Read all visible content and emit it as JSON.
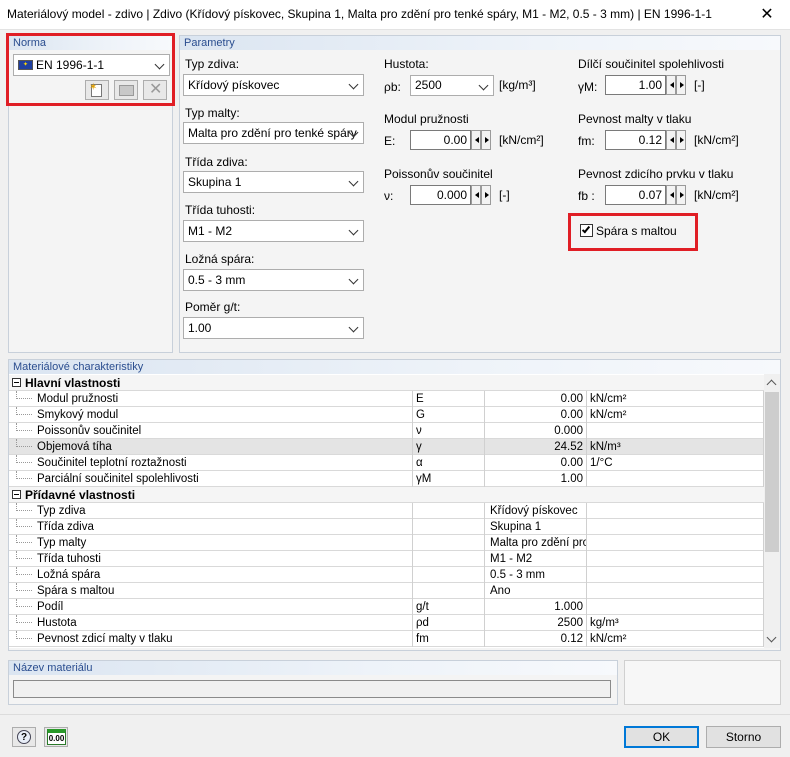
{
  "window": {
    "title": "Materiálový model - zdivo | Zdivo (Křídový pískovec, Skupina 1, Malta pro zdění pro tenké spáry, M1 - M2, 0.5 - 3 mm) | EN 1996-1-1",
    "close": "✕"
  },
  "norma": {
    "header": "Norma",
    "selected": "EN 1996-1-1"
  },
  "parametry": {
    "header": "Parametry",
    "typ_zdiva": {
      "label": "Typ zdiva:",
      "value": "Křídový pískovec"
    },
    "typ_malty": {
      "label": "Typ malty:",
      "value": "Malta pro zdění pro tenké spáry"
    },
    "trida_zdiva": {
      "label": "Třída zdiva:",
      "value": "Skupina 1"
    },
    "trida_tuhosti": {
      "label": "Třída tuhosti:",
      "value": "M1 - M2"
    },
    "lozna_spara": {
      "label": "Ložná spára:",
      "value": "0.5 - 3 mm"
    },
    "pomer": {
      "label": "Poměr g/t:",
      "value": "1.00"
    },
    "hustota": {
      "label": "Hustota:",
      "symbol": "ρb:",
      "value": "2500",
      "unit": "[kg/m³]"
    },
    "modul": {
      "label": "Modul pružnosti",
      "symbol": "E:",
      "value": "0.00",
      "unit": "[kN/cm²]"
    },
    "poisson": {
      "label": "Poissonův součinitel",
      "symbol": "ν:",
      "value": "0.000",
      "unit": "[-]"
    },
    "dilci": {
      "label": "Dílčí součinitel spolehlivosti",
      "symbol": "γM:",
      "value": "1.00",
      "unit": "[-]"
    },
    "pevnost_malty": {
      "label": "Pevnost malty v tlaku",
      "symbol": "fm:",
      "value": "0.12",
      "unit": "[kN/cm²]"
    },
    "pevnost_prvku": {
      "label": "Pevnost zdicího prvku v tlaku",
      "symbol": "fb :",
      "value": "0.07",
      "unit": "[kN/cm²]"
    },
    "spara_s_maltou": {
      "label": "Spára s maltou",
      "checked": true
    }
  },
  "charakteristiky": {
    "header": "Materiálové charakteristiky",
    "groups": [
      {
        "title": "Hlavní vlastnosti",
        "rows": [
          {
            "name": "Modul pružnosti",
            "sym": "E",
            "val": "0.00",
            "unit": "kN/cm²"
          },
          {
            "name": "Smykový modul",
            "sym": "G",
            "val": "0.00",
            "unit": "kN/cm²"
          },
          {
            "name": "Poissonův součinitel",
            "sym": "ν",
            "val": "0.000",
            "unit": ""
          },
          {
            "name": "Objemová tíha",
            "sym": "γ",
            "val": "24.52",
            "unit": "kN/m³"
          },
          {
            "name": "Součinitel teplotní roztažnosti",
            "sym": "α",
            "val": "0.00",
            "unit": "1/°C"
          },
          {
            "name": "Parciální součinitel spolehlivosti",
            "sym": "γM",
            "val": "1.00",
            "unit": ""
          }
        ]
      },
      {
        "title": "Přídavné vlastnosti",
        "rows": [
          {
            "name": "Typ zdiva",
            "sym": "",
            "val": "Křídový pískovec",
            "unit": ""
          },
          {
            "name": "Třída zdiva",
            "sym": "",
            "val": "Skupina 1",
            "unit": ""
          },
          {
            "name": "Typ malty",
            "sym": "",
            "val": "Malta pro zdění pro",
            "unit": ""
          },
          {
            "name": "Třída tuhosti",
            "sym": "",
            "val": "M1 - M2",
            "unit": ""
          },
          {
            "name": "Ložná spára",
            "sym": "",
            "val": "0.5 - 3 mm",
            "unit": ""
          },
          {
            "name": "Spára s maltou",
            "sym": "",
            "val": "Ano",
            "unit": ""
          },
          {
            "name": "Podíl",
            "sym": "g/t",
            "val": "1.000",
            "unit": ""
          },
          {
            "name": "Hustota",
            "sym": "ρd",
            "val": "2500",
            "unit": "kg/m³"
          },
          {
            "name": "Pevnost zdicí malty v tlaku",
            "sym": "fm",
            "val": "0.12",
            "unit": "kN/cm²"
          }
        ]
      }
    ]
  },
  "nazev": {
    "header": "Název materiálu",
    "value": ""
  },
  "footer": {
    "ok": "OK",
    "cancel": "Storno",
    "calc_label": "0.00"
  }
}
